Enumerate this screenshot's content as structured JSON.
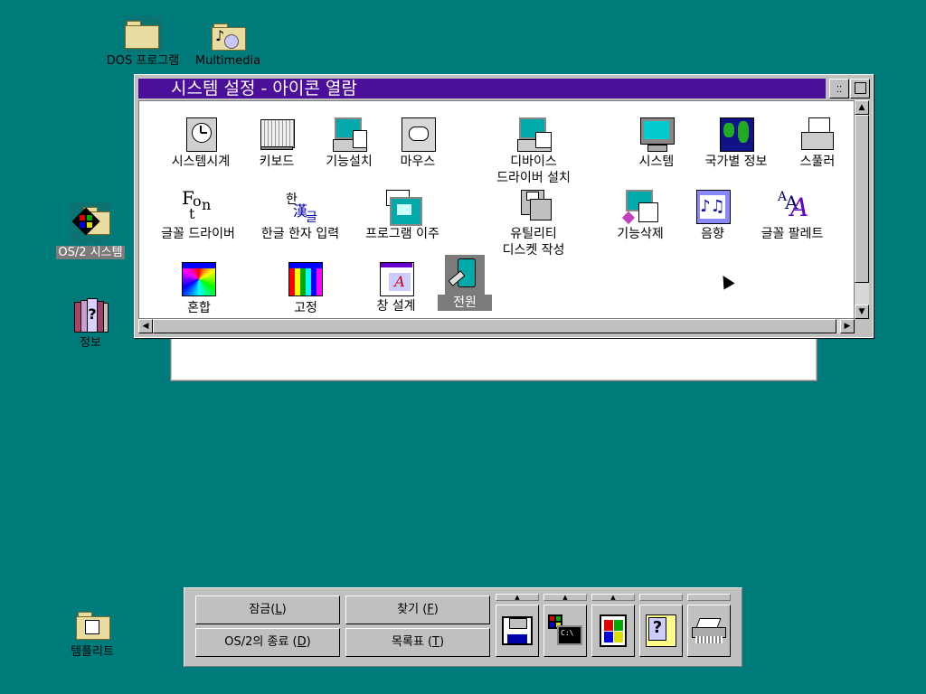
{
  "colors": {
    "desktop": "#007b7b",
    "titlebar": "#4b0f9a"
  },
  "desktop": {
    "icons": [
      {
        "id": "dos",
        "label": "DOS 프로그램",
        "icon": "folder-icon"
      },
      {
        "id": "mm",
        "label": "Multimedia",
        "icon": "multimedia-folder-icon"
      },
      {
        "id": "os2",
        "label": "OS/2 시스템",
        "icon": "os2-system-folder-icon"
      },
      {
        "id": "info",
        "label": "정보",
        "icon": "books-icon"
      },
      {
        "id": "tmpl",
        "label": "템플리트",
        "icon": "template-folder-icon"
      }
    ]
  },
  "window": {
    "title": "시스템 설정 - 아이콘 열람",
    "icons": [
      {
        "label": "시스템시계",
        "icon": "clock-icon"
      },
      {
        "label": "키보드",
        "icon": "keyboard-icon"
      },
      {
        "label": "기능설치",
        "icon": "computer-install-icon"
      },
      {
        "label": "마우스",
        "icon": "mouse-icon"
      },
      {
        "label": "디바이스",
        "label2": "드라이버 설치",
        "icon": "computer-device-icon"
      },
      {
        "label": "시스템",
        "icon": "monitor-icon"
      },
      {
        "label": "국가별 정보",
        "icon": "globe-icon"
      },
      {
        "label": "스풀러",
        "icon": "printer-icon"
      },
      {
        "label": "글꼴 드라이버",
        "icon": "font-icon"
      },
      {
        "label": "한글 한자 입력",
        "icon": "hangul-hanja-icon"
      },
      {
        "label": "프로그램 이주",
        "icon": "migrate-icon"
      },
      {
        "label": "유틸리티",
        "label2": "디스켓 작성",
        "icon": "diskette-icon"
      },
      {
        "label": "기능삭제",
        "icon": "remove-feature-icon"
      },
      {
        "label": "음향",
        "icon": "sound-icon"
      },
      {
        "label": "글꼴 팔레트",
        "icon": "font-palette-icon"
      },
      {
        "label": "혼합",
        "icon": "color-mix-icon"
      },
      {
        "label": "고정",
        "icon": "color-fixed-icon"
      },
      {
        "label": "창 설계",
        "icon": "window-design-icon"
      },
      {
        "label": "전원",
        "icon": "power-icon"
      }
    ]
  },
  "launchpad": {
    "buttons": {
      "lock": {
        "text": "잠금(",
        "key": "L",
        "end": ")"
      },
      "find": {
        "text": "찾기 (",
        "key": "F",
        "end": ")"
      },
      "shutdown": {
        "text": "OS/2의 종료 (",
        "key": "D",
        "end": ")"
      },
      "tasklist": {
        "text": "목록표  (",
        "key": "T",
        "end": ")"
      }
    },
    "tray_arrow": "▲",
    "cmd_prompt": "C:\\"
  }
}
